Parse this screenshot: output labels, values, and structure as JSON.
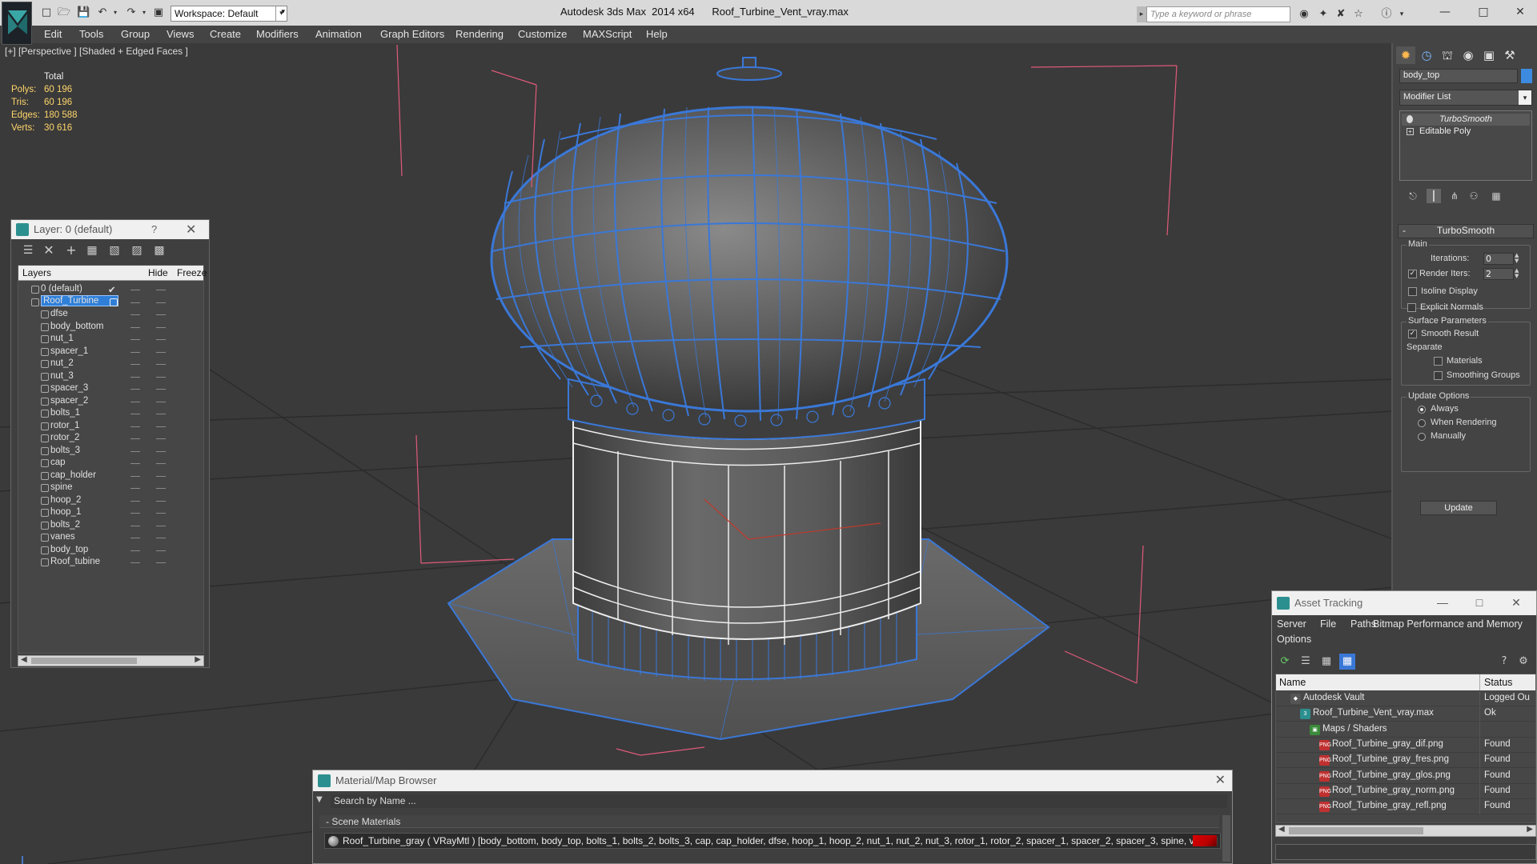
{
  "title_bar": {
    "app_title": "Autodesk 3ds Max  2014 x64",
    "file_name": "Roof_Turbine_Vent_vray.max",
    "workspace": "Workspace: Default",
    "search_placeholder": "Type a keyword or phrase"
  },
  "menu": [
    "Edit",
    "Tools",
    "Group",
    "Views",
    "Create",
    "Modifiers",
    "Animation",
    "Graph Editors",
    "Rendering",
    "Customize",
    "MAXScript",
    "Help"
  ],
  "viewport": {
    "label": "[+] [Perspective ] [Shaded + Edged Faces ]",
    "stats": {
      "header": "Total",
      "rows": [
        {
          "key": "Polys:",
          "value": "60 196"
        },
        {
          "key": "Tris:",
          "value": "60 196"
        },
        {
          "key": "Edges:",
          "value": "180 588"
        },
        {
          "key": "Verts:",
          "value": "30 616"
        }
      ]
    }
  },
  "layer_panel": {
    "title": "Layer: 0 (default)",
    "help": "?",
    "col_layers": "Layers",
    "col_hide": "Hide",
    "col_freeze": "Freeze",
    "rows": [
      {
        "name": "0 (default)",
        "level": 0,
        "checked": true
      },
      {
        "name": "Roof_Turbine",
        "level": 0,
        "selected": true
      },
      {
        "name": "dfse",
        "level": 1
      },
      {
        "name": "body_bottom",
        "level": 1
      },
      {
        "name": "nut_1",
        "level": 1
      },
      {
        "name": "spacer_1",
        "level": 1
      },
      {
        "name": "nut_2",
        "level": 1
      },
      {
        "name": "nut_3",
        "level": 1
      },
      {
        "name": "spacer_3",
        "level": 1
      },
      {
        "name": "spacer_2",
        "level": 1
      },
      {
        "name": "bolts_1",
        "level": 1
      },
      {
        "name": "rotor_1",
        "level": 1
      },
      {
        "name": "rotor_2",
        "level": 1
      },
      {
        "name": "bolts_3",
        "level": 1
      },
      {
        "name": "cap",
        "level": 1
      },
      {
        "name": "cap_holder",
        "level": 1
      },
      {
        "name": "spine",
        "level": 1
      },
      {
        "name": "hoop_2",
        "level": 1
      },
      {
        "name": "hoop_1",
        "level": 1
      },
      {
        "name": "bolts_2",
        "level": 1
      },
      {
        "name": "vanes",
        "level": 1
      },
      {
        "name": "body_top",
        "level": 1
      },
      {
        "name": "Roof_tubine",
        "level": 1
      }
    ]
  },
  "command_panel": {
    "object_name": "body_top",
    "object_color": "#3d8be0",
    "modifier_list": "Modifier List",
    "stack": [
      "TurboSmooth",
      "Editable Poly"
    ],
    "turbosmooth": {
      "header": "TurboSmooth",
      "main": "Main",
      "iterations_label": "Iterations:",
      "iterations": "0",
      "render_iters_label": "Render Iters:",
      "render_iters": "2",
      "isoline": "Isoline Display",
      "explicit_normals": "Explicit Normals",
      "surface_params": "Surface Parameters",
      "smooth_result": "Smooth Result",
      "separate": "Separate",
      "materials": "Materials",
      "smoothing_groups": "Smoothing Groups",
      "update_options": "Update Options",
      "always": "Always",
      "when_rendering": "When Rendering",
      "manually": "Manually",
      "update_button": "Update"
    }
  },
  "asset_tracking": {
    "title": "Asset Tracking",
    "menu": [
      "Server",
      "File",
      "Paths",
      "Bitmap Performance and Memory",
      "Options"
    ],
    "col_name": "Name",
    "col_status": "Status",
    "rows": [
      {
        "name": "Autodesk Vault",
        "status": "Logged Ou",
        "indent": 0,
        "icon": "vault"
      },
      {
        "name": "Roof_Turbine_Vent_vray.max",
        "status": "Ok",
        "indent": 1,
        "icon": "max"
      },
      {
        "name": "Maps / Shaders",
        "status": "",
        "indent": 2,
        "icon": "maps"
      },
      {
        "name": "Roof_Turbine_gray_dif.png",
        "status": "Found",
        "indent": 3,
        "icon": "png"
      },
      {
        "name": "Roof_Turbine_gray_fres.png",
        "status": "Found",
        "indent": 3,
        "icon": "png"
      },
      {
        "name": "Roof_Turbine_gray_glos.png",
        "status": "Found",
        "indent": 3,
        "icon": "png"
      },
      {
        "name": "Roof_Turbine_gray_norm.png",
        "status": "Found",
        "indent": 3,
        "icon": "png"
      },
      {
        "name": "Roof_Turbine_gray_refl.png",
        "status": "Found",
        "indent": 3,
        "icon": "png"
      }
    ]
  },
  "material_browser": {
    "title": "Material/Map Browser",
    "search": "Search by Name ...",
    "section": "- Scene Materials",
    "material": "Roof_Turbine_gray  ( VRayMtl ) [body_bottom, body_top, bolts_1, bolts_2, bolts_3, cap, cap_holder, dfse, hoop_1, hoop_2, nut_1, nut_2, nut_3, rotor_1, rotor_2, spacer_1, spacer_2, spacer_3, spine, vanes]"
  },
  "colors": {
    "wire_blue": "#3a78d8",
    "grid": "#2e2e2e",
    "stats_yellow": "#ffd66b"
  }
}
